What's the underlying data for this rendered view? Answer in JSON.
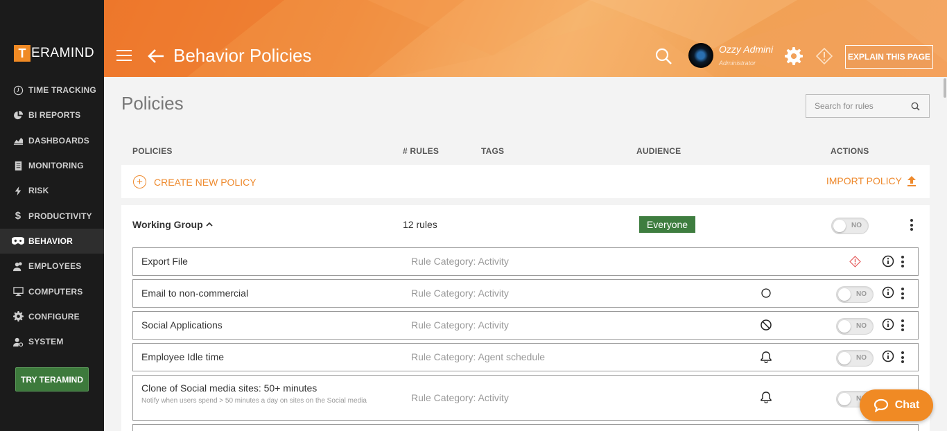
{
  "app": {
    "logo_letter": "T",
    "logo_text": "ERAMIND"
  },
  "sidebar": {
    "items": [
      {
        "label": "TIME TRACKING",
        "icon": "clock-icon"
      },
      {
        "label": "BI REPORTS",
        "icon": "pie-chart-icon"
      },
      {
        "label": "DASHBOARDS",
        "icon": "area-chart-icon"
      },
      {
        "label": "MONITORING",
        "icon": "document-icon"
      },
      {
        "label": "RISK",
        "icon": "lightning-icon"
      },
      {
        "label": "PRODUCTIVITY",
        "icon": "dollar-icon"
      },
      {
        "label": "BEHAVIOR",
        "icon": "gamepad-icon",
        "active": true
      },
      {
        "label": "EMPLOYEES",
        "icon": "users-icon"
      },
      {
        "label": "COMPUTERS",
        "icon": "monitor-icon"
      },
      {
        "label": "CONFIGURE",
        "icon": "gear-icon"
      },
      {
        "label": "SYSTEM",
        "icon": "user-gear-icon"
      }
    ],
    "try_button": "TRY TERAMIND"
  },
  "header": {
    "title": "Behavior Policies",
    "user_name": "Ozzy Admini",
    "user_role": "Administrator",
    "explain_button": "EXPLAIN THIS PAGE"
  },
  "main": {
    "title": "Policies",
    "search_placeholder": "Search for rules",
    "columns": {
      "policies": "POLICIES",
      "rules": "# RULES",
      "tags": "TAGS",
      "audience": "AUDIENCE",
      "actions": "ACTIONS"
    },
    "create_policy": "CREATE NEW POLICY",
    "import_policy": "IMPORT POLICY",
    "group": {
      "name": "Working Group",
      "rules_count": "12 rules",
      "audience": "Everyone",
      "toggle": "NO"
    },
    "rules": [
      {
        "name": "Export File",
        "category": "Rule Category: Activity",
        "action_icon": "alert-diamond-icon",
        "toggle": ""
      },
      {
        "name": "Email to non-commercial",
        "category": "Rule Category: Activity",
        "action_icon": "circle-icon",
        "toggle": "NO"
      },
      {
        "name": "Social Applications",
        "category": "Rule Category: Activity",
        "action_icon": "block-icon",
        "toggle": "NO"
      },
      {
        "name": "Employee Idle time",
        "category": "Rule Category: Agent schedule",
        "action_icon": "bell-icon",
        "toggle": "NO"
      },
      {
        "name": "Clone of Social media sites: 50+ minutes",
        "description": "Notify when users spend > 50 minutes a day on sites on the Social media",
        "category": "Rule Category: Activity",
        "action_icon": "bell-icon",
        "toggle": "NO"
      }
    ]
  },
  "chat": {
    "label": "Chat"
  },
  "colors": {
    "accent": "#f08a24",
    "audience_badge": "#3e7d3f",
    "sidebar": "#1b1b1b"
  }
}
